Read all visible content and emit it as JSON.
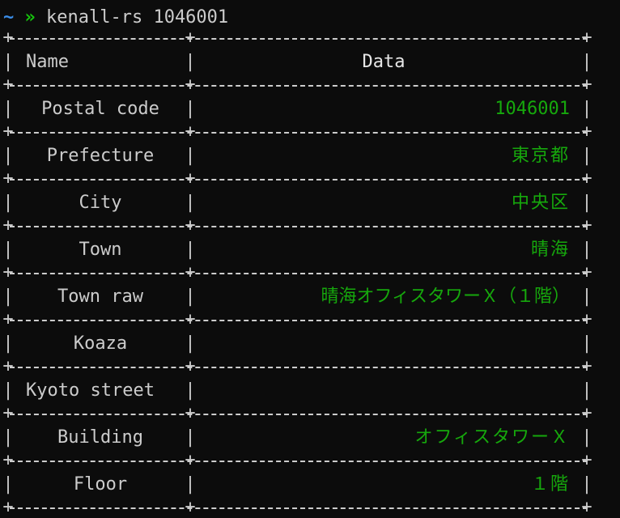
{
  "prompt": {
    "tilde": "~",
    "arrow": "»",
    "command": "kenall-rs 1046001"
  },
  "table": {
    "headers": [
      "Name",
      "Data"
    ],
    "rows": [
      {
        "name": "Postal code",
        "value": "1046001"
      },
      {
        "name": "Prefecture",
        "value": "東京都"
      },
      {
        "name": "City",
        "value": "中央区"
      },
      {
        "name": "Town",
        "value": "晴海"
      },
      {
        "name": "Town raw",
        "value": "晴海オフィスタワーＸ（１階）"
      },
      {
        "name": "Koaza",
        "value": ""
      },
      {
        "name": "Kyoto street",
        "value": ""
      },
      {
        "name": "Building",
        "value": "オフィスタワーＸ"
      },
      {
        "name": "Floor",
        "value": "１階"
      }
    ]
  },
  "colors": {
    "background": "#0c0c0c",
    "text": "#cccccc",
    "data": "#16a80c",
    "tilde": "#3b8eea",
    "arrow": "#16c60c"
  }
}
